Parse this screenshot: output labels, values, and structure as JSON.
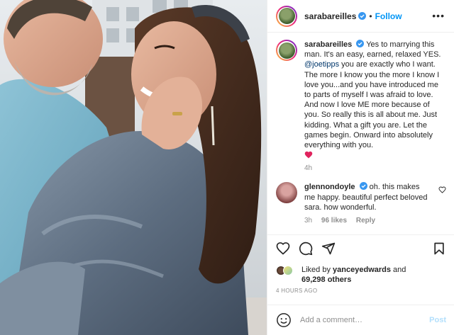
{
  "header": {
    "username": "sarabareilles",
    "separator": "•",
    "follow_label": "Follow",
    "more_icon": "more-horizontal-icon"
  },
  "caption": {
    "username": "sarabareilles",
    "text_before_mention": "Yes to marrying this man. It's an easy, earned, relaxed YES.",
    "mention": "@joetipps",
    "text_after_mention": "you are exactly who I want. The more I know you the more I know I love you...and you have introduced me to parts of myself I was afraid to love. And now I love ME more because of you. So really this is all about me. Just kidding. What a gift you are. Let the games begin. Onward into absolutely everything with you.",
    "emoji": "red-heart",
    "time": "4h"
  },
  "comments": [
    {
      "username": "glennondoyle",
      "text": "oh. this makes me happy. beautiful perfect beloved sara. how wonderful.",
      "time": "3h",
      "likes": "96 likes",
      "reply": "Reply"
    }
  ],
  "likes": {
    "prefix": "Liked by",
    "user": "yanceyedwards",
    "and": "and",
    "others": "69,298 others"
  },
  "timestamp": "4 HOURS AGO",
  "add_comment": {
    "placeholder": "Add a comment…",
    "post_label": "Post"
  },
  "colors": {
    "accent": "#0095f6",
    "post_disabled": "#b2dffc",
    "secondary_text": "#8e8e8e",
    "mention": "#00376b",
    "heart": "#ed4956"
  }
}
